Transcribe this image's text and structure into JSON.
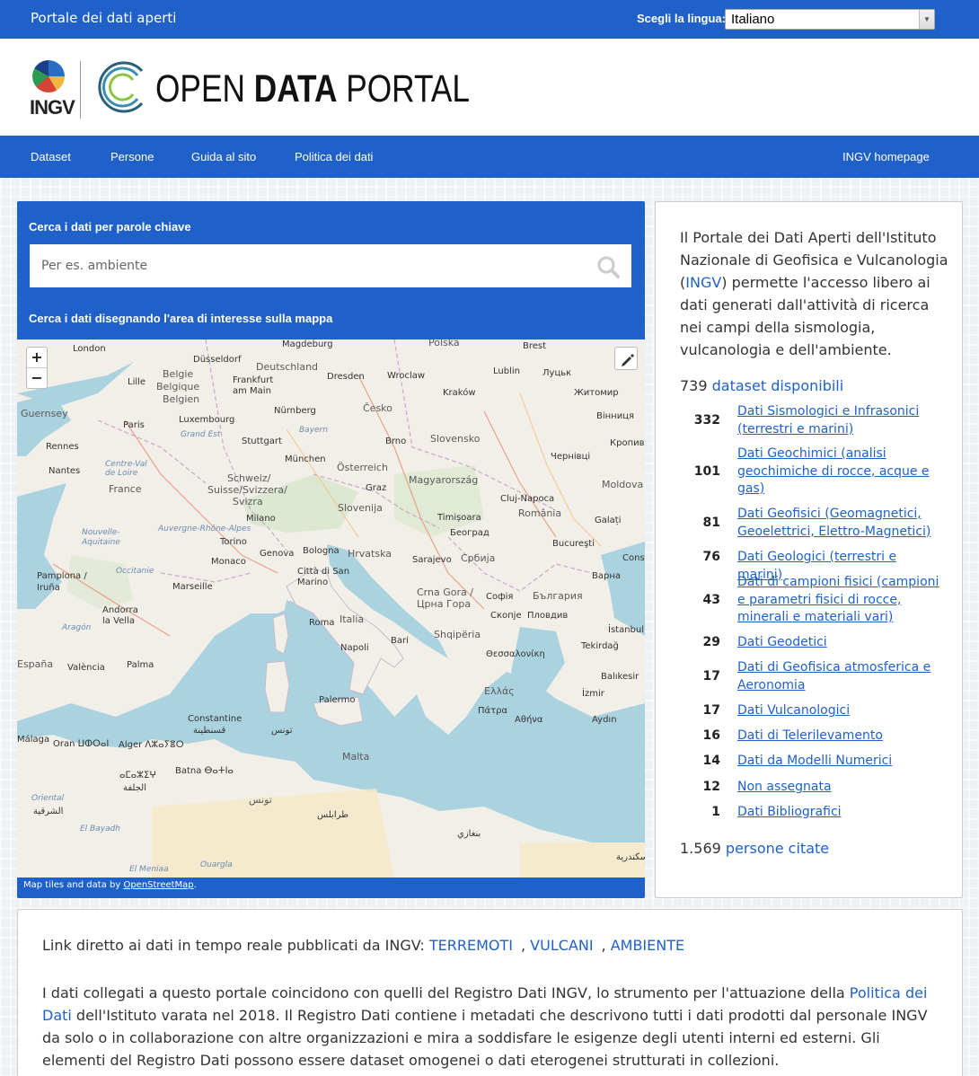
{
  "topbar": {
    "title": "Portale dei dati aperti",
    "language_label": "Scegli la lingua:",
    "language_value": "Italiano"
  },
  "brand": {
    "ingv": "INGV",
    "portal_word1": "OPEN ",
    "portal_word2": "DATA",
    "portal_word3": " PORTAL",
    "accent": "#1f61c8"
  },
  "nav": {
    "items": [
      "Dataset",
      "Persone",
      "Guida al sito",
      "Politica dei dati"
    ],
    "right_item": "INGV homepage"
  },
  "search": {
    "keyword_label": "Cerca i dati per parole chiave",
    "placeholder": "Per es. ambiente",
    "map_label": "Cerca i dati disegnando l'area di interesse sulla mappa"
  },
  "map": {
    "zoom_in": "+",
    "zoom_out": "−",
    "attribution_prefix": "Map tiles and data by ",
    "attribution_link": "OpenStreetMap",
    "attribution_suffix": ".",
    "labels": [
      "London",
      "Magdeburg",
      "Polska",
      "Brest",
      "Düsseldorf",
      "Deutschland",
      "Belgie",
      "Belgique",
      "Belgien",
      "Lille",
      "Frankfurt am Main",
      "Dresden",
      "Wroclaw",
      "Lublin",
      "Луцьк",
      "Guernsey",
      "Luxembourg",
      "Nürnberg",
      "Česko",
      "Kraków",
      "Житомир",
      "Paris",
      "Grand Est",
      "Bayern",
      "Вінниця",
      "Rennes",
      "Stuttgart",
      "Brno",
      "Slovensko",
      "Кропив",
      "Nantes",
      "Centre-Val de Loire",
      "München",
      "Österreich",
      "Чернівці",
      "France",
      "Schweiz/",
      "Suisse/Svizzera/",
      "Svizra",
      "Graz",
      "Magyarország",
      "Moldova",
      "Slovenija",
      "Cluj-Napoca",
      "Milano",
      "Timișoara",
      "România",
      "Nouvelle-Aquitaine",
      "Auvergne-Rhône-Alpes",
      "Torino",
      "Београд",
      "Galați",
      "Bologna",
      "Hrvatska",
      "Bucureşti",
      "Monaco",
      "Genova",
      "Occitanie",
      "Città di San Marino",
      "Sarajevo",
      "Србија",
      "Const",
      "Pamplona / Iruña",
      "Marseille",
      "Crna Gora / Црна Гора",
      "Софія",
      "България",
      "Варна",
      "Andorra la Vella",
      "Italia",
      "Roma",
      "Скопје",
      "Пловдив",
      "Shqipëria",
      "Aragón",
      "Napoli",
      "Bari",
      "Tekirdağ",
      "İstanbul",
      "España",
      "València",
      "Palma",
      "Θεσσαλονίκη",
      "Balıkesir",
      "Ελλάς",
      "İzmir",
      "Palermo",
      "Πάτρα",
      "Αθήνα",
      "Aydın",
      "Constantine",
      "قسنطينة",
      "Málaga",
      "Oran ⵡⵀⵔⴰⵏ",
      "Alger ⴷⵣⴰⵢⴻⵔ",
      "تونس",
      "Malta",
      "Batna ⴱⴰⵜⵏⴰ",
      "ⴰⵎⴰⵣⵉⵖ",
      "الجلفة",
      "تونس",
      "Oriental",
      "الشرقية",
      "طرابلس",
      "بنغازي",
      "El Bayadh",
      "El Meniaa",
      "Ouargla",
      "إسكندرية"
    ]
  },
  "info": {
    "intro_before": "Il Portale dei Dati Aperti dell'Istituto Nazionale di Geofisica e Vulcanologia (",
    "intro_link": "INGV",
    "intro_after": ") permette l'accesso libero ai dati generati dall'attività di ricerca nei campi della sismologia, vulcanologia e dell'ambiente.",
    "dataset_count": "739",
    "dataset_link": "dataset disponibili",
    "categories": [
      {
        "count": "332",
        "label": "Dati Sismologici e Infrasonici (terrestri e marini)"
      },
      {
        "count": "101",
        "label": "Dati Geochimici (analisi geochimiche di rocce, acque e gas)"
      },
      {
        "count": "81",
        "label": "Dati Geofisici (Geomagnetici, Geoelettrici, Elettro-Magnetici)"
      },
      {
        "count": "76",
        "label": "Dati Geologici (terrestri e marini)"
      },
      {
        "count": "43",
        "label": "Dati di campioni fisici (campioni e parametri fisici di rocce, minerali e materiali vari)"
      },
      {
        "count": "29",
        "label": "Dati Geodetici"
      },
      {
        "count": "17",
        "label": "Dati di Geofisica atmosferica e Aeronomia"
      },
      {
        "count": "17",
        "label": "Dati Vulcanologici"
      },
      {
        "count": "16",
        "label": "Dati di Telerilevamento"
      },
      {
        "count": "14",
        "label": "Dati da Modelli Numerici"
      },
      {
        "count": "12",
        "label": "Non assegnata"
      },
      {
        "count": "1",
        "label": "Dati Bibliografici"
      }
    ],
    "people_count": "1.569",
    "people_link": "persone citate"
  },
  "bottom": {
    "realtime_prefix": "Link diretto ai dati in tempo reale pubblicati da INGV: ",
    "realtime_links": [
      "TERREMOTI",
      "VULCANI",
      "AMBIENTE"
    ],
    "desc_before": "I dati collegati a questo portale coincidono con quelli del Registro Dati INGV, lo strumento per l'attuazione della ",
    "desc_link": "Politica dei Dati",
    "desc_after": " dell'Istituto varata nel 2018. Il Registro Dati contiene i metadati che descrivono tutti i dati prodotti dal personale INGV da solo o in collaborazione con altre organizzazioni e mira a soddisfare le esigenze degli utenti interni ed esterni. Gli elementi del Registro Dati possono essere dataset omogenei o dati eterogenei strutturati in collezioni."
  }
}
